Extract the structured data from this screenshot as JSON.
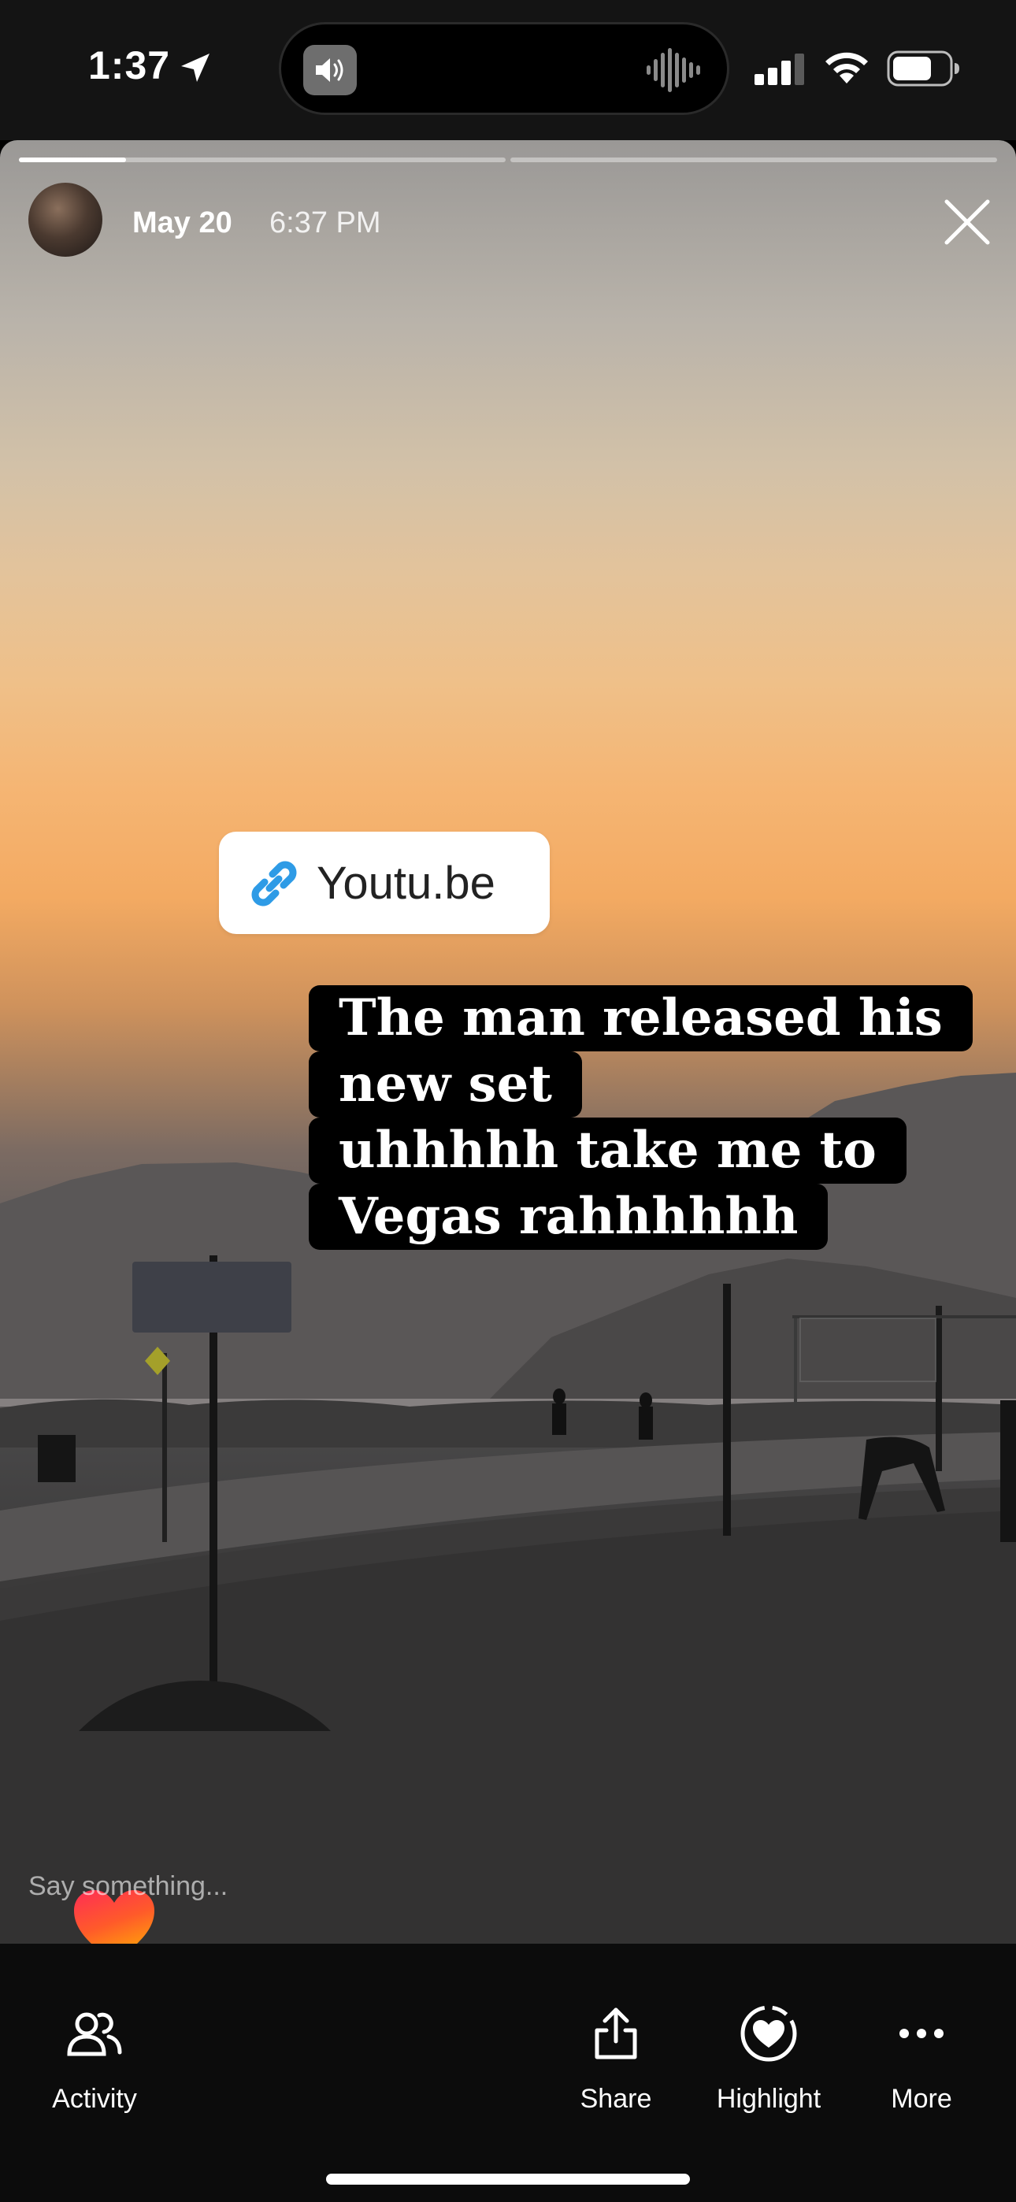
{
  "status_bar": {
    "time": "1:37",
    "icons": [
      "location-arrow-icon",
      "speaker-icon",
      "waveform-icon",
      "cellular-signal-icon",
      "wifi-icon",
      "battery-icon"
    ]
  },
  "story": {
    "progress": [
      {
        "filled": 0.22
      },
      {
        "filled": 0
      }
    ],
    "date": "May 20",
    "time": "6:37 PM",
    "link_sticker": {
      "label": "Youtu.be",
      "icon": "link-icon",
      "icon_color": "#2e9be6"
    },
    "caption_lines": [
      "The man released his",
      "new set",
      "uhhhhh take me to",
      "Vegas rahhhhhh"
    ],
    "reply_placeholder": "Say something...",
    "reaction_icon": "heart-icon"
  },
  "bottom_bar": {
    "actions": [
      {
        "label": "Activity",
        "icon": "activity-people-icon"
      },
      {
        "label": "Share",
        "icon": "share-icon"
      },
      {
        "label": "Highlight",
        "icon": "highlight-heart-icon"
      },
      {
        "label": "More",
        "icon": "more-dots-icon"
      }
    ]
  },
  "colors": {
    "link_blue": "#2e9be6",
    "caption_bg": "#000000",
    "heart_top": "#ff2d55",
    "heart_bottom": "#ff9f0a"
  }
}
